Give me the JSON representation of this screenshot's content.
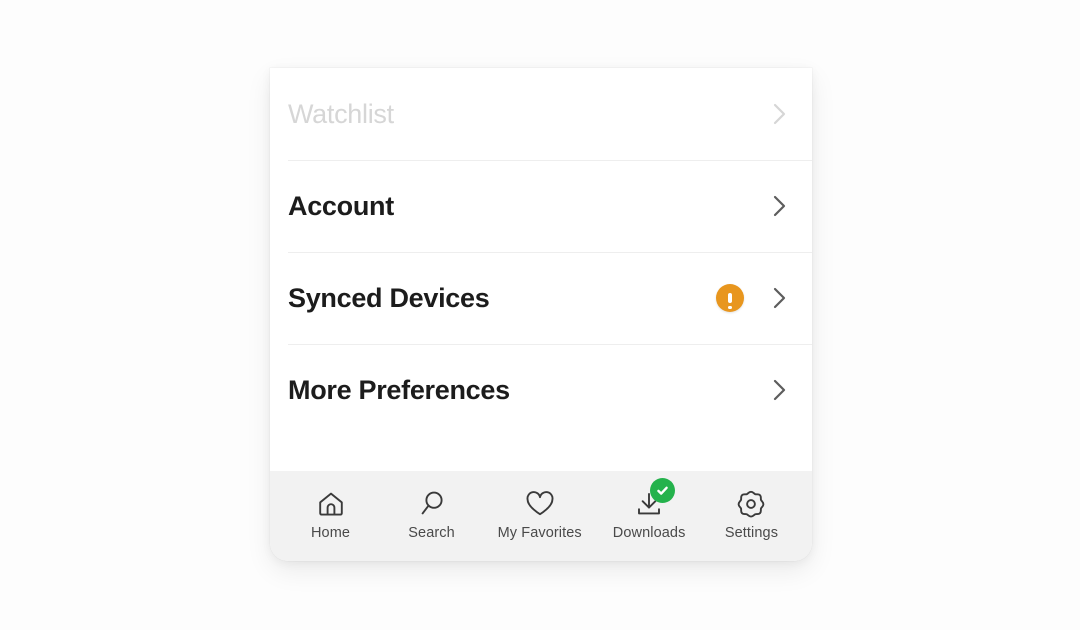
{
  "background_color": "#fdfdfd",
  "card": {
    "background_color": "#ffffff",
    "menu": [
      {
        "label": "Watchlist",
        "state": "disabled",
        "chevron_icon": "chevron-right-icon",
        "badge": null
      },
      {
        "label": "Account",
        "state": "enabled",
        "chevron_icon": "chevron-right-icon",
        "badge": null
      },
      {
        "label": "Synced Devices",
        "state": "enabled",
        "chevron_icon": "chevron-right-icon",
        "badge": {
          "type": "warning",
          "icon": "alert-exclamation-icon",
          "color": "#e8961e"
        }
      },
      {
        "label": "More Preferences",
        "state": "enabled",
        "chevron_icon": "chevron-right-icon",
        "badge": null
      }
    ]
  },
  "bottom_nav": {
    "background_color": "#f2f2f2",
    "items": [
      {
        "label": "Home",
        "icon": "home-icon",
        "badge": null
      },
      {
        "label": "Search",
        "icon": "search-icon",
        "badge": null
      },
      {
        "label": "My Favorites",
        "icon": "heart-icon",
        "badge": null
      },
      {
        "label": "Downloads",
        "icon": "download-icon",
        "badge": {
          "type": "success",
          "icon": "check-icon",
          "color": "#24b24c"
        }
      },
      {
        "label": "Settings",
        "icon": "gear-icon",
        "badge": null
      }
    ]
  }
}
